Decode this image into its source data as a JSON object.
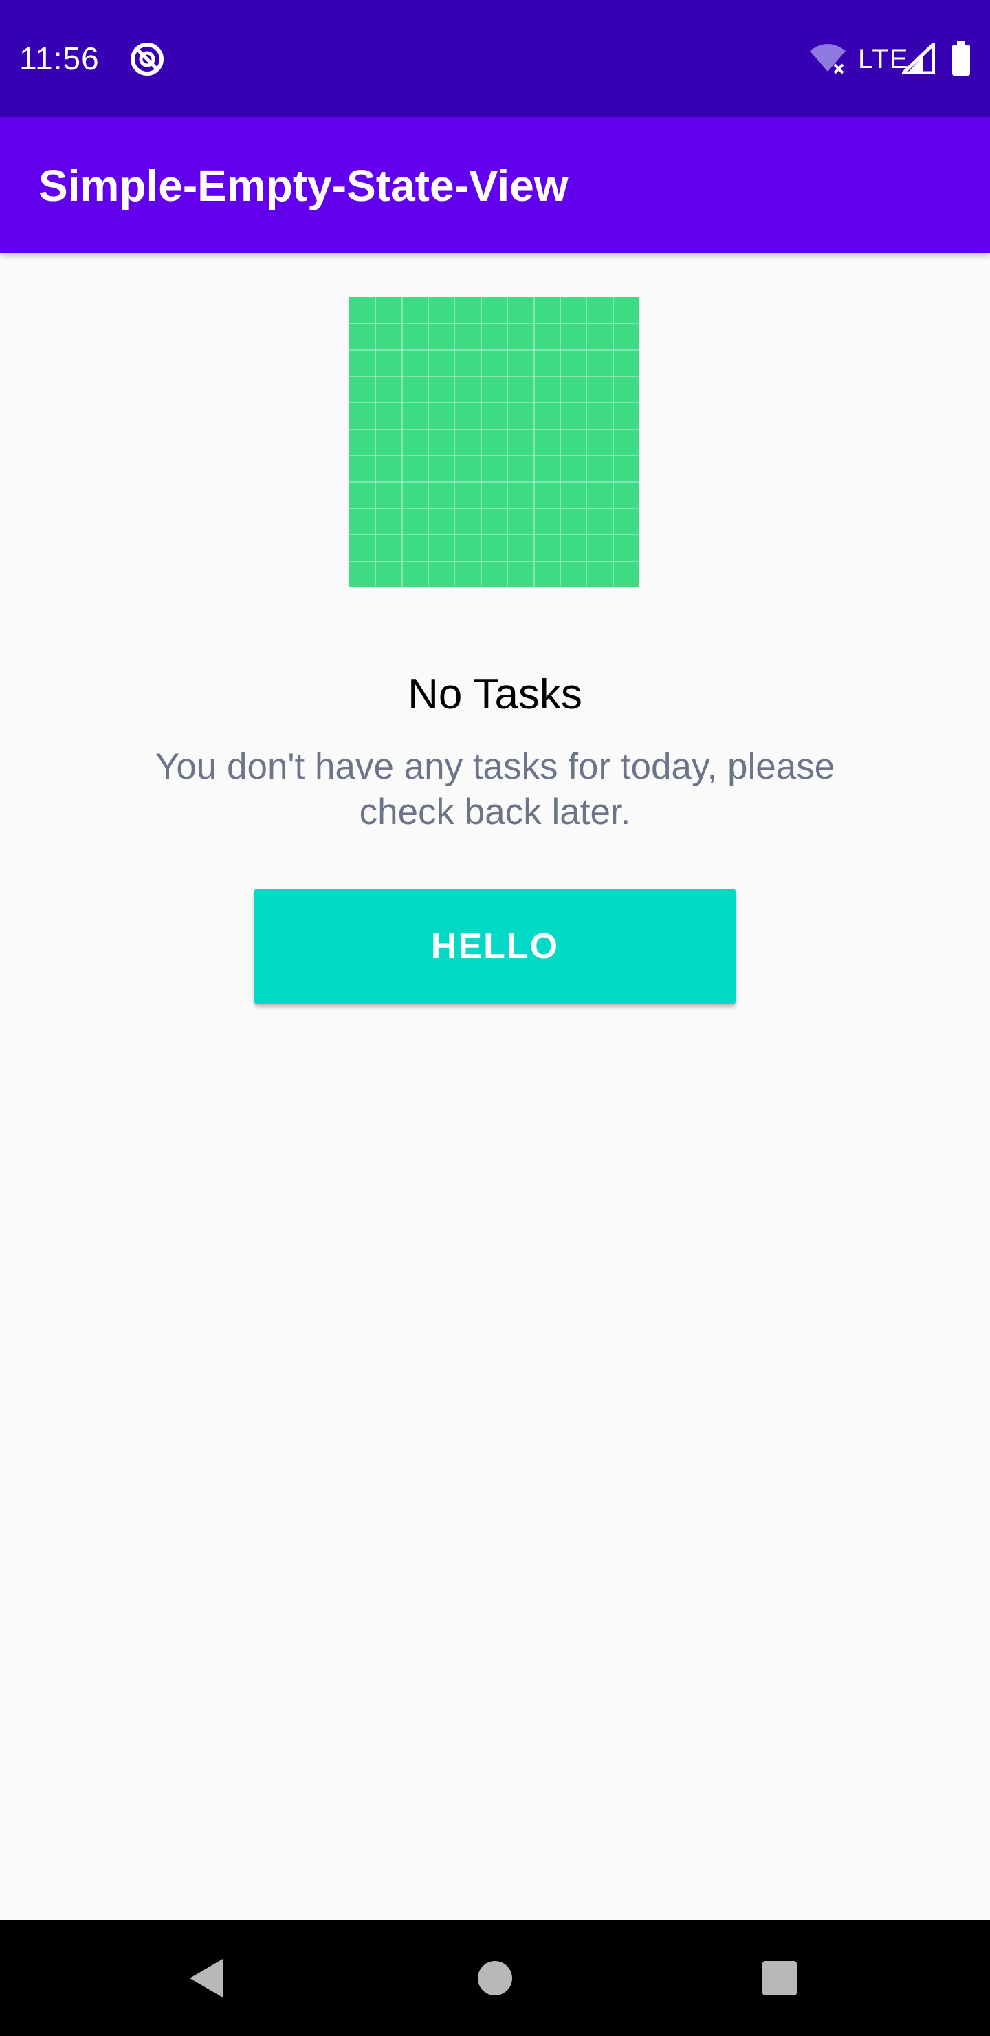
{
  "status_bar": {
    "time": "11:56",
    "network_label": "LTE",
    "background_color": "#3700B3",
    "icons": [
      "notification-icon",
      "wifi-off-icon",
      "cell-signal-icon",
      "battery-icon"
    ]
  },
  "app_bar": {
    "title": "Simple-Empty-State-View",
    "background_color": "#6200EE"
  },
  "empty_state": {
    "illustration": {
      "icon": "grid-placeholder-icon",
      "color": "#3DDC84",
      "grid_cells": 11
    },
    "title": "No Tasks",
    "message": "You don't have any tasks for today, please check back later.",
    "message_color": "#6B7489",
    "button_label": "HELLO",
    "button_color": "#03DAC6"
  },
  "nav_bar": {
    "buttons": [
      "back-icon",
      "home-icon",
      "recents-icon"
    ],
    "background_color": "#000000"
  }
}
